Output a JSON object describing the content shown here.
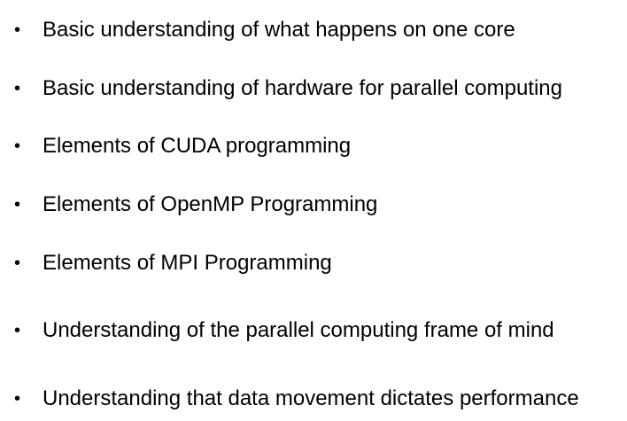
{
  "bullet_symbol": "•",
  "items": [
    "Basic understanding of what happens on one core",
    "Basic understanding of hardware for parallel computing",
    "Elements of CUDA programming",
    "Elements of OpenMP Programming",
    "Elements of MPI Programming",
    "Understanding of the parallel computing frame of mind",
    "Understanding that data movement dictates performance"
  ]
}
